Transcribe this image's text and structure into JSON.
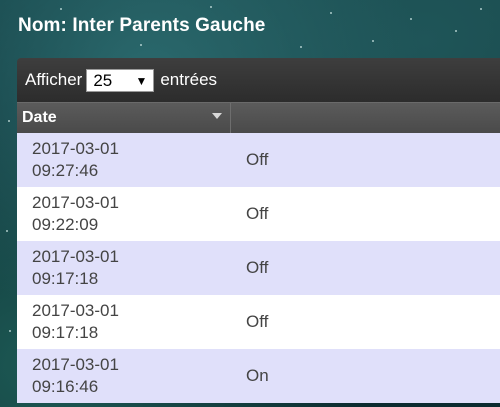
{
  "title": "Nom: Inter Parents Gauche",
  "toolbar": {
    "show_label": "Afficher",
    "page_length": "25",
    "entries_label": "entrées"
  },
  "table": {
    "columns": [
      "Date",
      ""
    ],
    "rows": [
      {
        "date": "2017-03-01",
        "time": "09:27:46",
        "value": "Off"
      },
      {
        "date": "2017-03-01",
        "time": "09:22:09",
        "value": "Off"
      },
      {
        "date": "2017-03-01",
        "time": "09:17:18",
        "value": "Off"
      },
      {
        "date": "2017-03-01",
        "time": "09:17:18",
        "value": "Off"
      },
      {
        "date": "2017-03-01",
        "time": "09:16:46",
        "value": "On"
      }
    ]
  },
  "colors": {
    "row_odd": "#e0e0fa",
    "row_even": "#ffffff",
    "header_bg": "#4a4a4a",
    "toolbar_bg": "#2c2c2c"
  }
}
